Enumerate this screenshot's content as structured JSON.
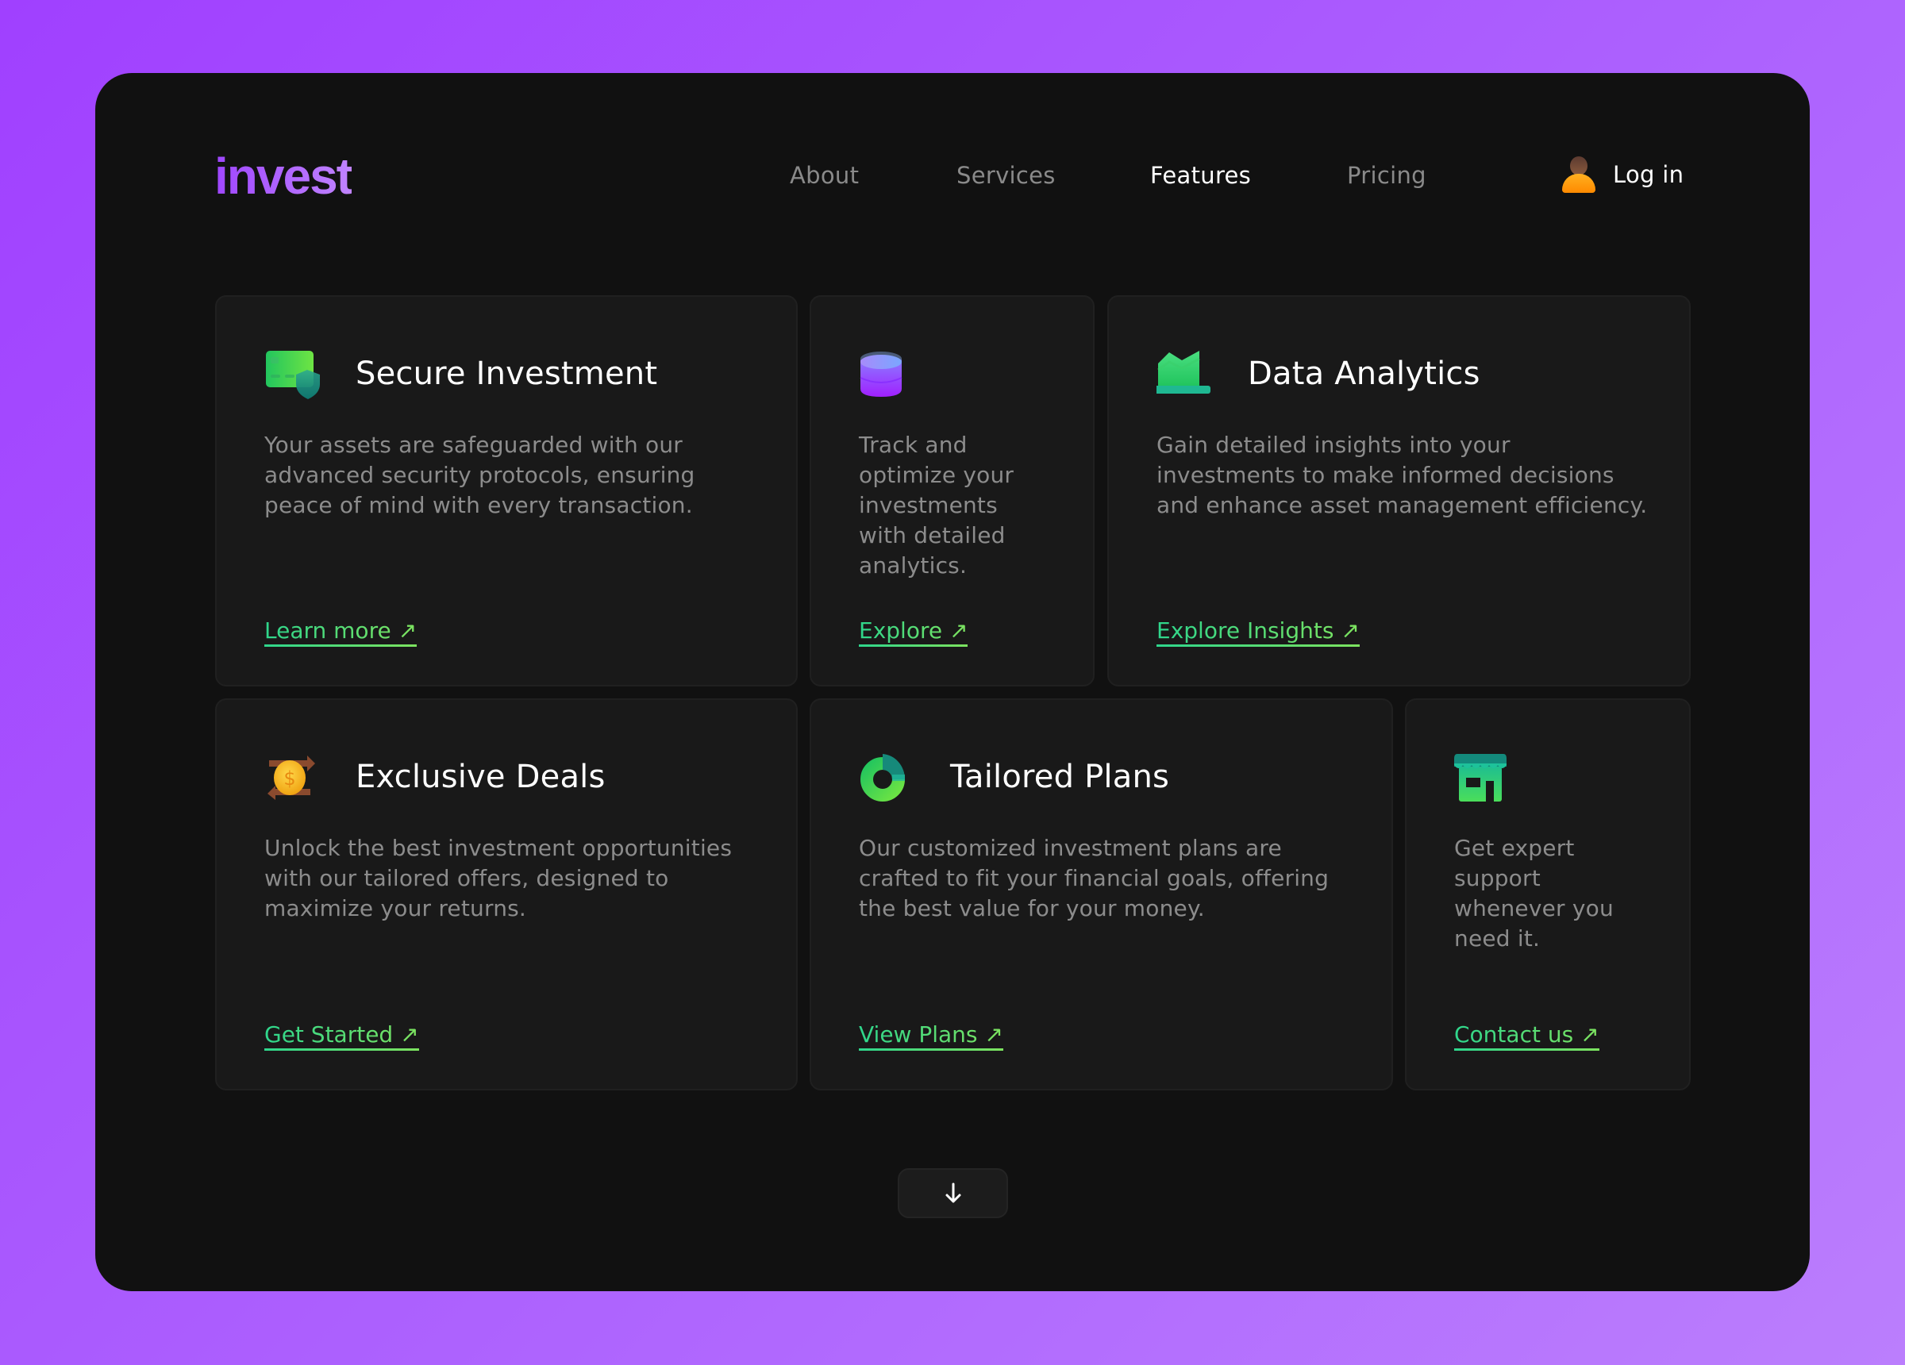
{
  "header": {
    "logo": "invest",
    "nav": [
      {
        "label": "About",
        "active": false
      },
      {
        "label": "Services",
        "active": false
      },
      {
        "label": "Features",
        "active": true
      },
      {
        "label": "Pricing",
        "active": false
      }
    ],
    "login": {
      "label": "Log in",
      "icon": "user-avatar-icon"
    }
  },
  "colors": {
    "accent_purple": "#a142fe",
    "link_green_start": "#2ed68c",
    "link_green_end": "#7de35f",
    "card_bg": "#191919",
    "frame_bg": "#111111"
  },
  "cards": [
    {
      "icon": "credit-card-shield-icon",
      "title": "Secure Investment",
      "description": "Your assets are safeguarded with our advanced security protocols, ensuring peace of mind with every transaction.",
      "link": "Learn more ↗"
    },
    {
      "icon": "database-stack-icon",
      "title": "",
      "description": "Track and optimize your investments with detailed analytics.",
      "link": "Explore ↗"
    },
    {
      "icon": "area-chart-icon",
      "title": "Data Analytics",
      "description": "Gain detailed insights into your investments to make informed decisions and enhance asset management efficiency.",
      "link": "Explore Insights ↗"
    },
    {
      "icon": "coin-exchange-icon",
      "title": "Exclusive Deals",
      "description": "Unlock the best investment opportunities with our tailored offers, designed to maximize your returns.",
      "link": "Get Started ↗"
    },
    {
      "icon": "donut-chart-icon",
      "title": "Tailored Plans",
      "description": "Our customized investment plans are crafted to fit your financial goals, offering the best value for your money.",
      "link": "View Plans ↗"
    },
    {
      "icon": "storefront-icon",
      "title": "",
      "description": "Get expert support whenever you need it.",
      "link": "Contact us ↗"
    }
  ],
  "scroll_button": {
    "icon": "arrow-down-icon"
  }
}
